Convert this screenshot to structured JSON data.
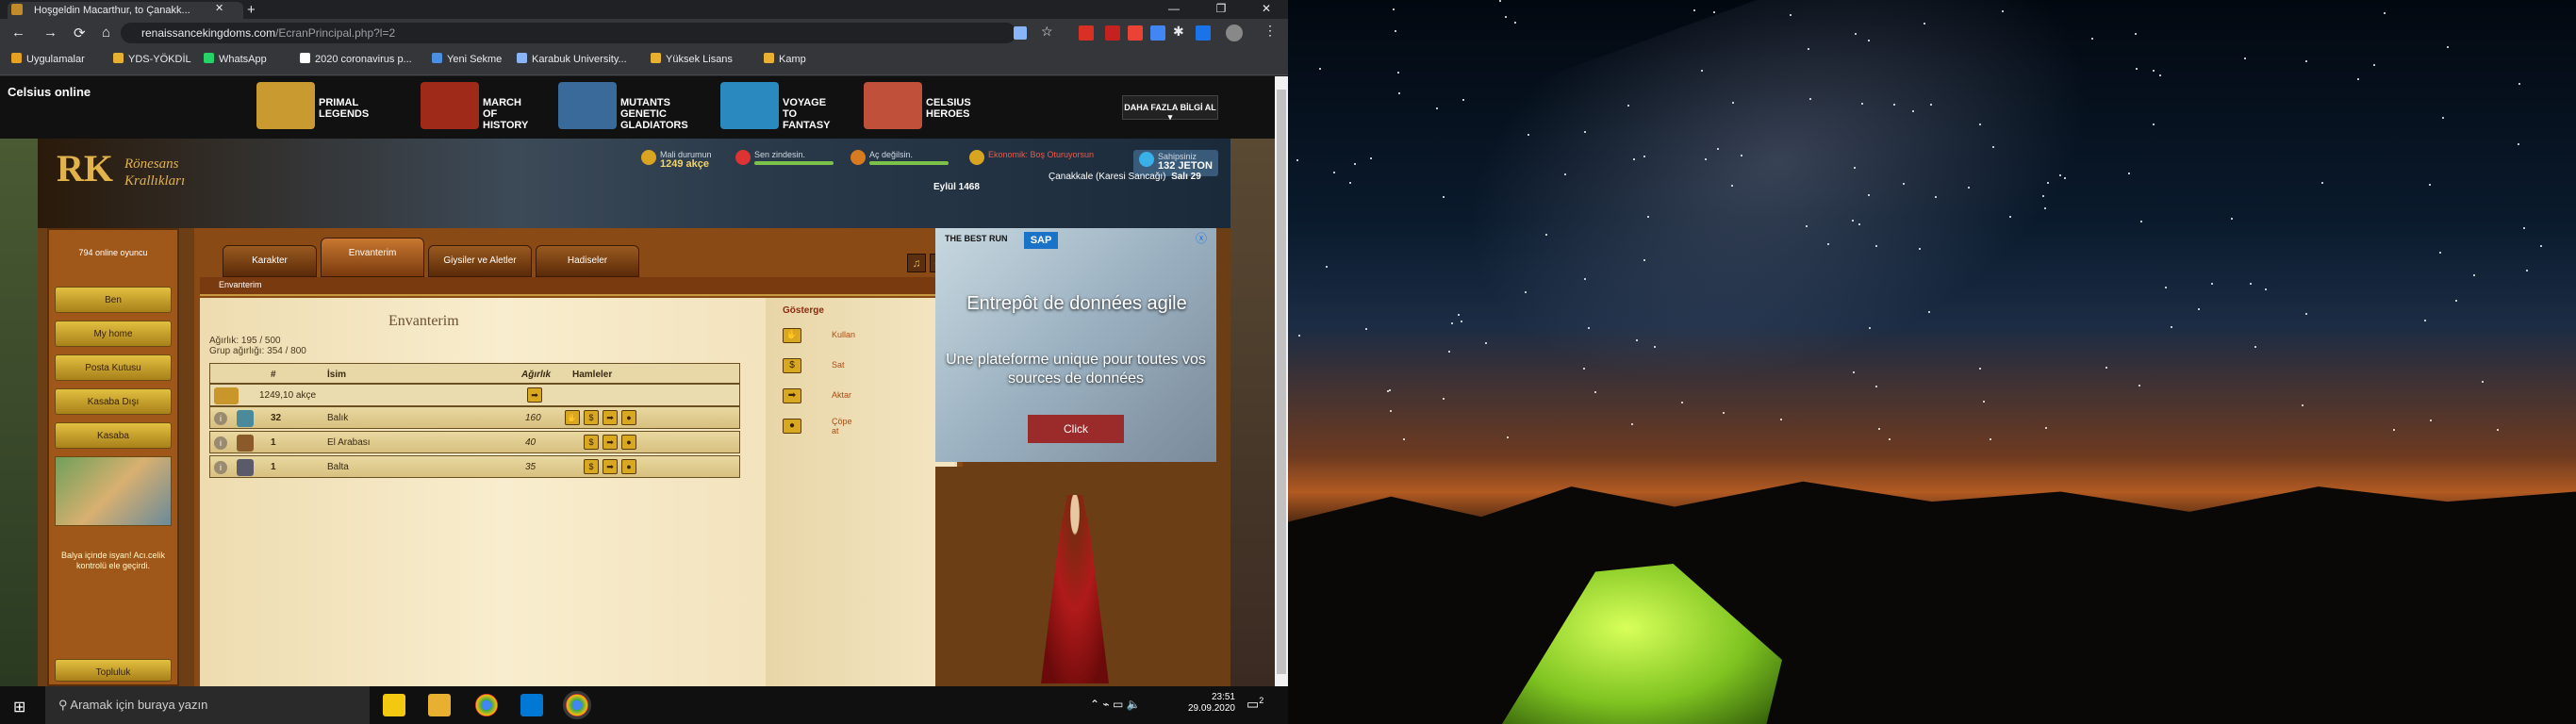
{
  "browser": {
    "tab_title": "Hoşgeldin Macarthur, to Çanakk...",
    "url_domain": "renaissancekingdoms.com",
    "url_path": "/EcranPrincipal.php?l=2",
    "nav": {
      "back": "←",
      "forward": "→",
      "reload": "⟳",
      "home": "⌂"
    },
    "window_controls": {
      "minimize": "—",
      "maximize": "❐",
      "close": "✕"
    },
    "new_tab": "+",
    "bookmarks": [
      {
        "label": "Uygulamalar",
        "color": "#e8a020"
      },
      {
        "label": "YDS-YÖKDİL",
        "color": "#e8b030"
      },
      {
        "label": "WhatsApp",
        "color": "#25d366"
      },
      {
        "label": "2020 coronavirus p...",
        "color": "#ffffff"
      },
      {
        "label": "Yeni Sekme",
        "color": "#4a90e2"
      },
      {
        "label": "Karabuk University...",
        "color": "#8ab4f8"
      },
      {
        "label": "Yüksek Lisans",
        "color": "#e8b030"
      },
      {
        "label": "Kamp",
        "color": "#e8b030"
      }
    ]
  },
  "adbar": {
    "brand": "Celsius online",
    "games": [
      {
        "label": "PRIMAL LEGENDS",
        "color": "#c89a30"
      },
      {
        "label": "MARCH OF HISTORY",
        "color": "#a02a1a"
      },
      {
        "label": "MUTANTS GENETIC GLADIATORS",
        "color": "#3a6a9a"
      },
      {
        "label": "VOYAGE TO FANTASY",
        "color": "#2a8ac0"
      },
      {
        "label": "CELSIUS HEROES",
        "color": "#c0503a"
      }
    ],
    "more_info": "DAHA FAZLA BİLGİ AL ▾"
  },
  "header": {
    "logo_letters": "RK",
    "logo_text_1": "Rönesans",
    "logo_text_2": "Krallıkları",
    "money_label": "Mali durumun",
    "money_value": "1249 akçe",
    "health_label": "Sen zindesin.",
    "hunger_label": "Aç değilsin.",
    "job_label": "Ekonomik: Boş Oturuyorsun",
    "owner_label": "Sahipsiniz",
    "owner_value": "132 JETON",
    "location": "Çanakkale (Karesi Sancağı)",
    "date": "Salı 29 Eylül 1468"
  },
  "left": {
    "online": "794 online oyuncu",
    "buttons": [
      "Ben",
      "My home",
      "Posta Kutusu",
      "Kasaba Dışı",
      "Kasaba"
    ],
    "revolt": "Balya içinde isyan! Acı.celik kontrolü ele geçirdi.",
    "community": "Topluluk"
  },
  "tabs": [
    "Karakter",
    "Envanterim",
    "Giysiler ve Aletler",
    "Hadiseler"
  ],
  "active_tab": "Envanterim",
  "subheader": "Envanterim",
  "inventory": {
    "title": "Envanterim",
    "weight": "Ağırlık: 195 / 500",
    "group_weight": "Grup ağırlığı: 354 / 800",
    "columns": {
      "count": "#",
      "name": "İsim",
      "weight": "Ağırlık",
      "actions": "Hamleler"
    },
    "money_row": "1249,10 akçe",
    "rows": [
      {
        "count": "32",
        "name": "Balık",
        "weight": "160"
      },
      {
        "count": "1",
        "name": "El Arabası",
        "weight": "40"
      },
      {
        "count": "1",
        "name": "Balta",
        "weight": "35"
      }
    ]
  },
  "legend": {
    "title": "Gösterge",
    "items": [
      {
        "icon": "hand-icon",
        "label": "Kullan"
      },
      {
        "icon": "coin-icon",
        "label": "Sat"
      },
      {
        "icon": "arrow-icon",
        "label": "Aktar"
      },
      {
        "icon": "trash-icon",
        "label": "Çöpe at"
      }
    ]
  },
  "ad": {
    "brand_text": "THE BEST RUN",
    "brand_logo": "SAP",
    "headline": "Entrepôt de données agile",
    "body": "Une plateforme unique pour toutes vos sources de données",
    "cta": "Click"
  },
  "taskbar": {
    "search_placeholder": "Aramak için buraya yazın",
    "time": "23:51",
    "date": "29.09.2020",
    "notifications": "2"
  }
}
